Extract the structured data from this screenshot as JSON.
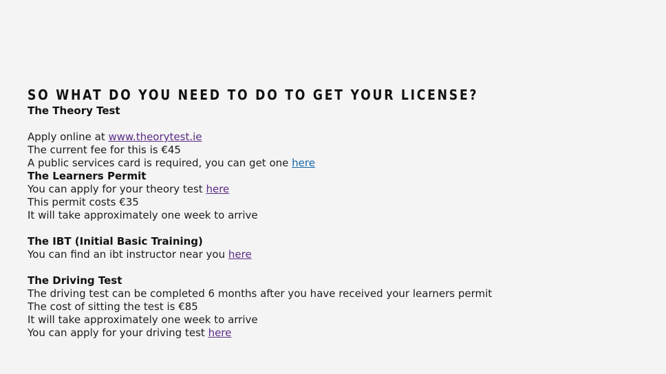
{
  "page": {
    "heading": "SO WHAT DO YOU NEED TO DO TO GET YOUR LICENSE?"
  },
  "theory_test": {
    "title": "The Theory Test",
    "apply_text": "Apply online at",
    "apply_link": "www.theorytest.ie",
    "fee_text": "The current fee for this is €45",
    "card_text": "A public services card is required, you can get one",
    "card_link": "here"
  },
  "learners_permit": {
    "title": "The Learners Permit",
    "apply_text": "You can apply for your theory test",
    "apply_link": "here",
    "cost_text": "This permit costs €35",
    "arrive_text": "It will take approximately one week to arrive"
  },
  "ibt": {
    "title": "The IBT (Initial Basic Training)",
    "find_text": "You can find an ibt instructor near you",
    "find_link": "here"
  },
  "driving_test": {
    "title": "The Driving Test",
    "timing_text": "The driving test can be completed 6 months after you have received your learners permit",
    "cost_text": "The cost of sitting the test is €85",
    "arrive_text": "It will take approximately one week to arrive",
    "apply_text": "You can apply for your driving test",
    "apply_link": "here"
  },
  "colors": {
    "background": "#f4f4f4",
    "text": "#1b1b1b",
    "visited_link": "#5a2a84",
    "unvisited_link": "#1565a8"
  }
}
